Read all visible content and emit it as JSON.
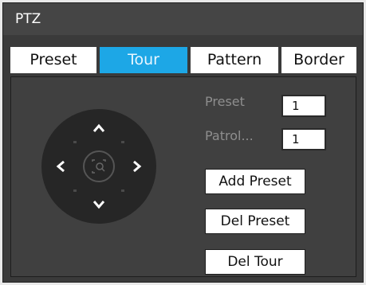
{
  "window": {
    "title": "PTZ"
  },
  "tabs": [
    {
      "label": "Preset",
      "active": false
    },
    {
      "label": "Tour",
      "active": true
    },
    {
      "label": "Pattern",
      "active": false
    },
    {
      "label": "Border",
      "active": false
    }
  ],
  "colors": {
    "accent": "#1da7e6",
    "panel": "#3a3a3a",
    "label": "#8e8e8e"
  },
  "direction_pad": {
    "icons": [
      "arrow-up-icon",
      "arrow-down-icon",
      "arrow-left-icon",
      "arrow-right-icon",
      "zoom-box-icon"
    ]
  },
  "form": {
    "preset_label": "Preset",
    "preset_value": "1",
    "patrol_label": "Patrol...",
    "patrol_value": "1"
  },
  "buttons": {
    "add_preset": "Add Preset",
    "del_preset": "Del Preset",
    "del_tour": "Del Tour"
  }
}
